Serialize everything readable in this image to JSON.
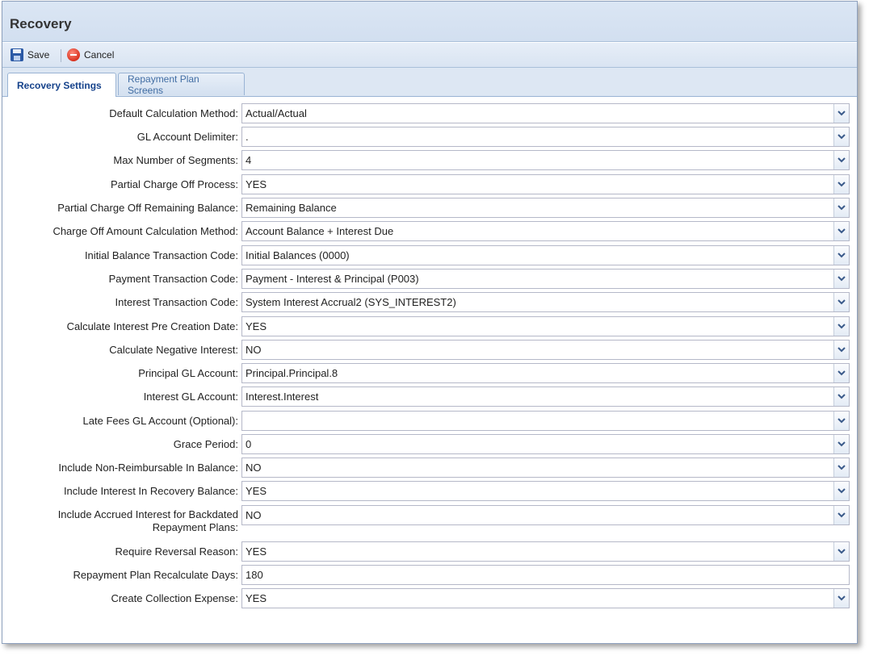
{
  "window": {
    "title": "Recovery"
  },
  "toolbar": {
    "save_label": "Save",
    "cancel_label": "Cancel"
  },
  "tabs": [
    {
      "label": "Recovery Settings",
      "active": true
    },
    {
      "label": "Repayment Plan Screens",
      "active": false
    }
  ],
  "fields": [
    {
      "label": "Default Calculation Method:",
      "value": "Actual/Actual",
      "type": "select"
    },
    {
      "label": "GL Account Delimiter:",
      "value": ".",
      "type": "select"
    },
    {
      "label": "Max Number of Segments:",
      "value": "4",
      "type": "select"
    },
    {
      "label": "Partial Charge Off Process:",
      "value": "YES",
      "type": "select"
    },
    {
      "label": "Partial Charge Off Remaining Balance:",
      "value": "Remaining Balance",
      "type": "select"
    },
    {
      "label": "Charge Off Amount Calculation Method:",
      "value": "Account Balance + Interest Due",
      "type": "select"
    },
    {
      "label": "Initial Balance Transaction Code:",
      "value": "Initial Balances (0000)",
      "type": "select"
    },
    {
      "label": "Payment Transaction Code:",
      "value": "Payment - Interest & Principal (P003)",
      "type": "select"
    },
    {
      "label": "Interest Transaction Code:",
      "value": "System Interest Accrual2 (SYS_INTEREST2)",
      "type": "select"
    },
    {
      "label": "Calculate Interest Pre Creation Date:",
      "value": "YES",
      "type": "select"
    },
    {
      "label": "Calculate Negative Interest:",
      "value": "NO",
      "type": "select"
    },
    {
      "label": "Principal GL Account:",
      "value": "Principal.Principal.8",
      "type": "select"
    },
    {
      "label": "Interest GL Account:",
      "value": "Interest.Interest",
      "type": "select"
    },
    {
      "label": "Late Fees GL Account (Optional):",
      "value": "",
      "type": "select"
    },
    {
      "label": "Grace Period:",
      "value": "0",
      "type": "select"
    },
    {
      "label": "Include Non-Reimbursable In Balance:",
      "value": "NO",
      "type": "select"
    },
    {
      "label": "Include Interest In Recovery Balance:",
      "value": "YES",
      "type": "select"
    },
    {
      "label_line1": "Include Accrued Interest for Backdated",
      "label_line2": "Repayment Plans:",
      "value": "NO",
      "type": "select"
    },
    {
      "label": "Require Reversal Reason:",
      "value": "YES",
      "type": "select"
    },
    {
      "label": "Repayment Plan Recalculate Days:",
      "value": "180",
      "type": "text"
    },
    {
      "label": "Create Collection Expense:",
      "value": "YES",
      "type": "select"
    }
  ]
}
